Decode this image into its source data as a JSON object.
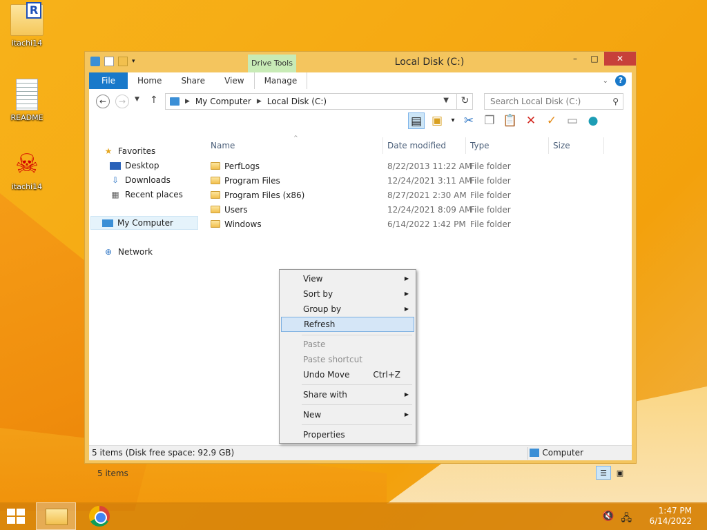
{
  "desktop": {
    "icons": [
      {
        "label": "itachi14"
      },
      {
        "label": "README"
      },
      {
        "label": "itachi14"
      }
    ]
  },
  "window": {
    "title": "Local Disk (C:)",
    "context_tab_group": "Drive Tools",
    "tabs": [
      "File",
      "Home",
      "Share",
      "View",
      "Manage"
    ],
    "controls": {
      "minimize": "–",
      "maximize": "□",
      "close": "✕"
    }
  },
  "address": {
    "crumbs": [
      "My Computer",
      "Local Disk (C:)"
    ],
    "search_placeholder": "Search Local Disk (C:)"
  },
  "navpane": {
    "favorites": "Favorites",
    "fav_items": [
      "Desktop",
      "Downloads",
      "Recent places"
    ],
    "my_computer": "My Computer",
    "network": "Network"
  },
  "columns": [
    "Name",
    "Date modified",
    "Type",
    "Size"
  ],
  "files": [
    {
      "name": "PerfLogs",
      "date": "8/22/2013 11:22 AM",
      "type": "File folder"
    },
    {
      "name": "Program Files",
      "date": "12/24/2021 3:11 AM",
      "type": "File folder"
    },
    {
      "name": "Program Files (x86)",
      "date": "8/27/2021 2:30 AM",
      "type": "File folder"
    },
    {
      "name": "Users",
      "date": "12/24/2021 8:09 AM",
      "type": "File folder"
    },
    {
      "name": "Windows",
      "date": "6/14/2022 1:42 PM",
      "type": "File folder"
    }
  ],
  "item_count": "5 items",
  "status": {
    "left": "5 items (Disk free space: 92.9 GB)",
    "right": "Computer"
  },
  "context_menu": {
    "view": "View",
    "sort_by": "Sort by",
    "group_by": "Group by",
    "refresh": "Refresh",
    "paste": "Paste",
    "paste_shortcut": "Paste shortcut",
    "undo_move": "Undo Move",
    "undo_shortcut": "Ctrl+Z",
    "share_with": "Share with",
    "new": "New",
    "properties": "Properties"
  },
  "taskbar": {
    "time": "1:47 PM",
    "date": "6/14/2022"
  }
}
